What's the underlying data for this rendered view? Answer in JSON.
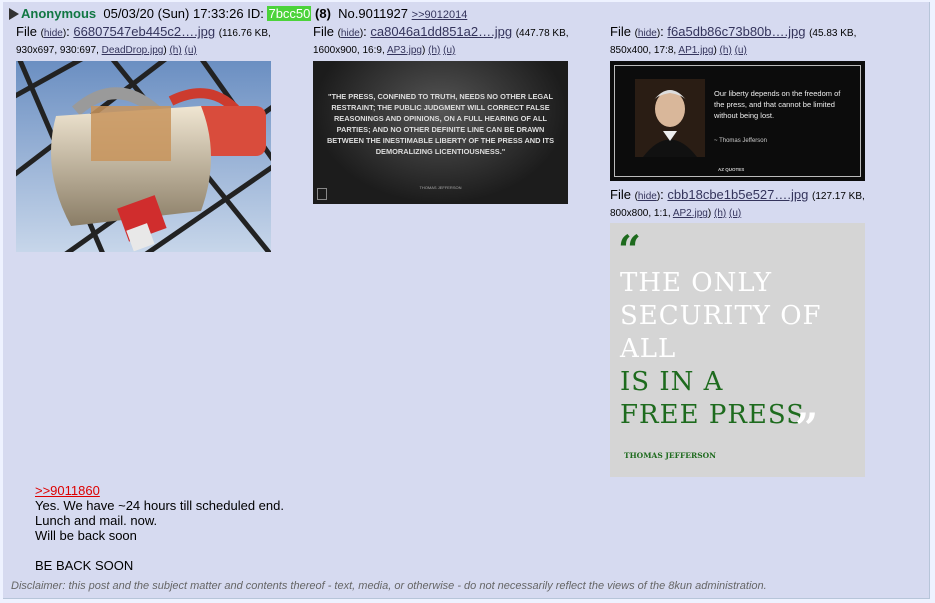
{
  "post": {
    "name": "Anonymous",
    "date": "05/03/20 (Sun) 17:33:26",
    "id_label": "ID:",
    "id": "7bcc50",
    "reply_count": "(8)",
    "number": "No.9011927",
    "backlink": ">>9012014"
  },
  "files": [
    {
      "label": "File",
      "hide": "hide",
      "name": "66807547eb445c2….jpg",
      "meta": "(116.76 KB,",
      "dims": "930x697, 930:697,",
      "orig": "DeadDrop.jpg",
      "h": "(h)",
      "u": "(u)",
      "image_desc_icon": "padlock-usb-image"
    },
    {
      "label": "File",
      "hide": "hide",
      "name": "ca8046a1dd851a2….jpg",
      "meta": "(447.78 KB,",
      "dims": "1600x900, 16:9,",
      "orig": "AP3.jpg",
      "h": "(h)",
      "u": "(u)",
      "quote_text": "\"THE PRESS, CONFINED TO TRUTH, NEEDS NO OTHER LEGAL RESTRAINT; THE PUBLIC JUDGMENT WILL CORRECT FALSE REASONINGS AND OPINIONS, ON A FULL HEARING OF ALL PARTIES; AND NO OTHER DEFINITE LINE CAN BE DRAWN BETWEEN THE INESTIMABLE LIBERTY OF THE PRESS AND ITS DEMORALIZING LICENTIOUSNESS.\"",
      "quote_author": "THOMAS JEFFERSON"
    },
    {
      "label": "File",
      "hide": "hide",
      "name": "f6a5db86c73b80b….jpg",
      "meta": "(45.83 KB,",
      "dims": "850x400, 17:8,",
      "orig": "AP1.jpg",
      "h": "(h)",
      "u": "(u)",
      "quote_text": "Our liberty depends on the freedom of the press, and that cannot be limited without being lost.",
      "quote_author": "~ Thomas Jefferson",
      "brand": "AZ QUOTES"
    },
    {
      "label": "File",
      "hide": "hide",
      "name": "cbb18cbe1b5e527….jpg",
      "meta": "(127.17 KB,",
      "dims": "800x800, 1:1,",
      "orig": "AP2.jpg",
      "h": "(h)",
      "u": "(u)",
      "quote_line1": "THE ONLY",
      "quote_line2": "SECURITY OF",
      "quote_line3": "ALL",
      "quote_line4": "IS IN A",
      "quote_line5": "FREE PRESS",
      "quote_author": "THOMAS JEFFERSON"
    }
  ],
  "body": {
    "quote_link": ">>9011860",
    "line1": "Yes. We have ~24 hours till scheduled end.",
    "line2": "Lunch and mail. now.",
    "line3": "Will be back soon",
    "line4": "BE BACK SOON"
  },
  "disclaimer": "Disclaimer: this post and the subject matter and contents thereof - text, media, or otherwise - do not necessarily reflect the views of the 8kun administration.",
  "colors": {
    "name": "#117743",
    "id_bg": "#4cd33b",
    "quote_link": "#dd0000",
    "post_bg": "#d6daf0",
    "page_bg": "#eef2ff"
  }
}
